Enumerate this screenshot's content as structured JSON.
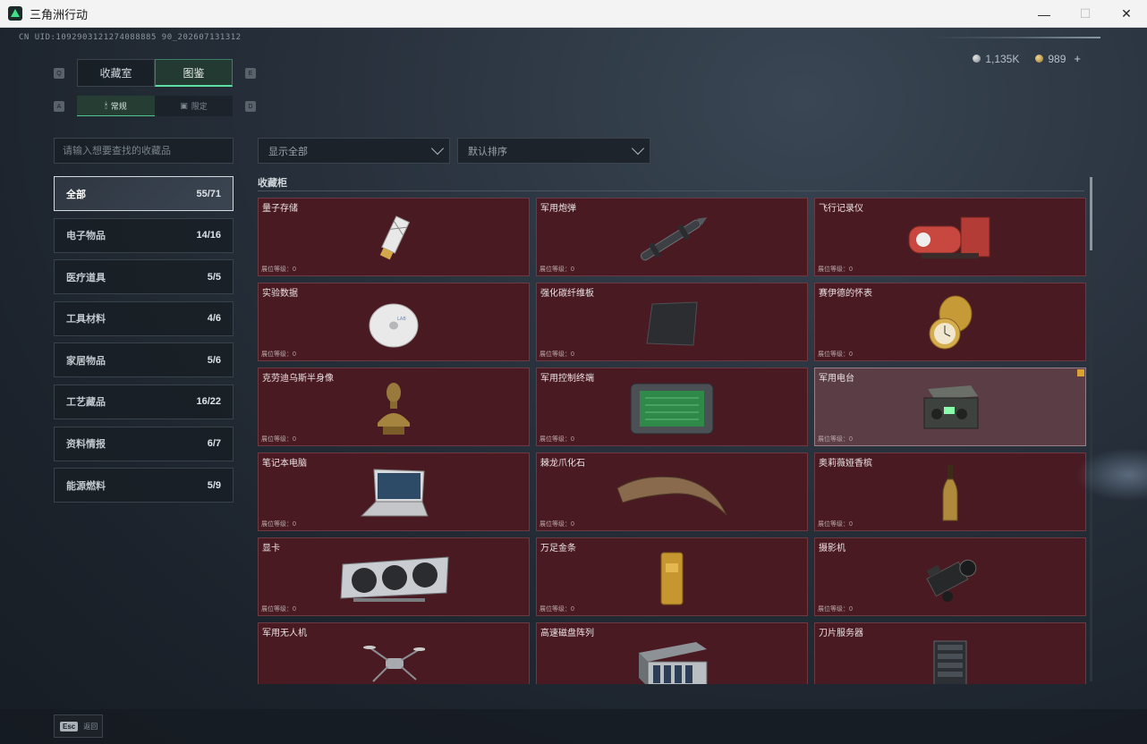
{
  "window": {
    "title": "三角洲行动",
    "minimize": "—",
    "maximize": "☐",
    "close": "✕"
  },
  "uid": "CN UID:1092903121274088885 90_202607131312",
  "currency": {
    "silver": "1,135K",
    "gold": "989",
    "plus": "+"
  },
  "tabs": {
    "keys": {
      "left": "Q",
      "right": "E",
      "sub_left": "A",
      "sub_right": "D"
    },
    "main": [
      {
        "label": "收藏室"
      },
      {
        "label": "图鉴"
      }
    ],
    "sub": [
      {
        "label": "常规"
      },
      {
        "label": "限定"
      }
    ]
  },
  "search": {
    "placeholder": "请输入想要查找的收藏品"
  },
  "filters": {
    "display": "显示全部",
    "sort": "默认排序"
  },
  "categories": [
    {
      "name": "全部",
      "count": "55/71"
    },
    {
      "name": "电子物品",
      "count": "14/16"
    },
    {
      "name": "医疗道具",
      "count": "5/5"
    },
    {
      "name": "工具材料",
      "count": "4/6"
    },
    {
      "name": "家居物品",
      "count": "5/6"
    },
    {
      "name": "工艺藏品",
      "count": "16/22"
    },
    {
      "name": "资料情报",
      "count": "6/7"
    },
    {
      "name": "能源燃料",
      "count": "5/9"
    }
  ],
  "collection": {
    "title": "收藏柜",
    "level_label": "展位等级：0",
    "items": [
      {
        "name": "量子存储",
        "icon": "usb-drive"
      },
      {
        "name": "军用炮弹",
        "icon": "shell"
      },
      {
        "name": "飞行记录仪",
        "icon": "flight-recorder"
      },
      {
        "name": "实验数据",
        "icon": "disc"
      },
      {
        "name": "强化碳纤维板",
        "icon": "carbon-plate"
      },
      {
        "name": "赛伊德的怀表",
        "icon": "pocket-watch"
      },
      {
        "name": "克劳迪乌斯半身像",
        "icon": "bust"
      },
      {
        "name": "军用控制终端",
        "icon": "control-terminal"
      },
      {
        "name": "军用电台",
        "icon": "radio"
      },
      {
        "name": "笔记本电脑",
        "icon": "laptop"
      },
      {
        "name": "棘龙爪化石",
        "icon": "claw-fossil"
      },
      {
        "name": "奥莉薇娅香槟",
        "icon": "champagne"
      },
      {
        "name": "显卡",
        "icon": "graphics-card"
      },
      {
        "name": "万足金条",
        "icon": "gold-bar"
      },
      {
        "name": "摄影机",
        "icon": "camera"
      },
      {
        "name": "军用无人机",
        "icon": "drone"
      },
      {
        "name": "高速磁盘阵列",
        "icon": "disk-array"
      },
      {
        "name": "刀片服务器",
        "icon": "blade-server"
      }
    ]
  },
  "bottom": {
    "esc_key": "Esc",
    "esc_label": "返回"
  },
  "colors": {
    "accent": "#5fe0a3",
    "card_bg": "#4a1a22",
    "card_highlight": "#5a3d45"
  }
}
